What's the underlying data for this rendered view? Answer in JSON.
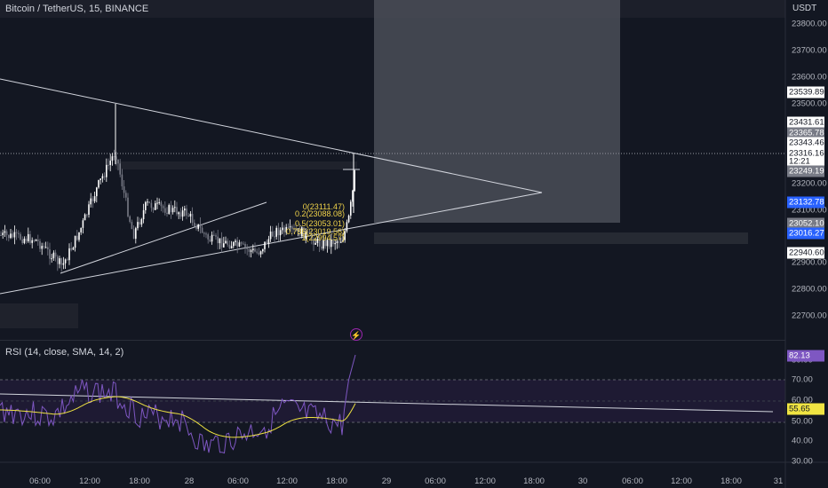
{
  "symbol": {
    "title": "Bitcoin / TetherUS, 15, BINANCE",
    "currency": "USDT"
  },
  "rsi": {
    "title": "RSI (14, close, SMA, 14, 2)",
    "value_label": "82.13",
    "sma_label": "55.65",
    "ticks": [
      "80.00",
      "70.00",
      "60.00",
      "50.00",
      "40.00",
      "30.00"
    ]
  },
  "price_axis": {
    "ticks": [
      "23800.00",
      "23700.00",
      "23600.00",
      "23500.00",
      "23200.00",
      "23100.00",
      "22900.00",
      "22800.00",
      "22700.00"
    ],
    "labels": [
      {
        "text": "23539.89",
        "bg": "#ffffff",
        "fg": "#131722"
      },
      {
        "text": "23431.61",
        "bg": "#ffffff",
        "fg": "#131722"
      },
      {
        "text": "23365.78",
        "bg": "#787b86",
        "fg": "#ffffff"
      },
      {
        "text": "23343.46",
        "bg": "#ffffff",
        "fg": "#131722"
      },
      {
        "text": "23316.16",
        "bg": "#ffffff",
        "fg": "#131722"
      },
      {
        "text": "12:21",
        "bg": "#ffffff",
        "fg": "#131722"
      },
      {
        "text": "23249.19",
        "bg": "#787b86",
        "fg": "#ffffff"
      },
      {
        "text": "23132.78",
        "bg": "#2962ff",
        "fg": "#ffffff"
      },
      {
        "text": "23052.10",
        "bg": "#787b86",
        "fg": "#ffffff"
      },
      {
        "text": "23016.27",
        "bg": "#2962ff",
        "fg": "#ffffff"
      },
      {
        "text": "22940.60",
        "bg": "#ffffff",
        "fg": "#131722"
      }
    ]
  },
  "time_axis": {
    "labels": [
      "06:00",
      "12:00",
      "18:00",
      "28",
      "06:00",
      "12:00",
      "18:00",
      "29",
      "06:00",
      "12:00",
      "18:00",
      "30",
      "06:00",
      "12:00",
      "18:00",
      "31"
    ]
  },
  "fib_levels": [
    "0(23111.47)",
    "0.2(23088.08)",
    "0.5(23053.01)",
    "0.786(23019.56)",
    "1(22994.57)"
  ],
  "colors": {
    "background": "#131722",
    "up_candle": "#ffffff",
    "down_candle": "#787b86",
    "rsi_line": "#7e57c2",
    "rsi_sma": "#f0e442",
    "trendline": "#d1d4dc",
    "fib": "#f0d34a",
    "blue_label": "#2962ff"
  }
}
